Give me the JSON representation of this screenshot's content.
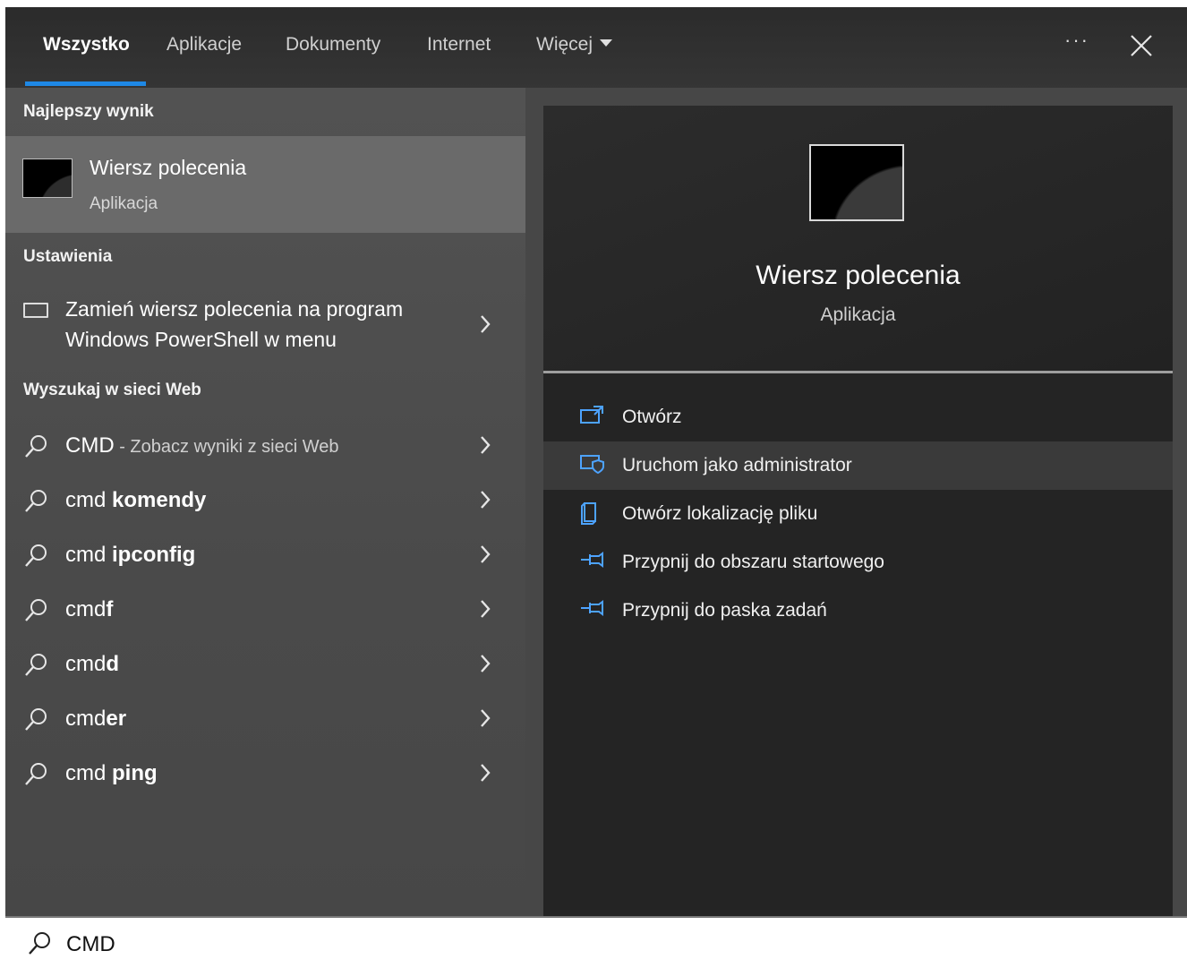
{
  "tabs": [
    {
      "label": "Wszystko",
      "active": true
    },
    {
      "label": "Aplikacje"
    },
    {
      "label": "Dokumenty"
    },
    {
      "label": "Internet"
    },
    {
      "label": "Więcej"
    }
  ],
  "top_actions": {
    "more": "···"
  },
  "best_match": {
    "heading": "Najlepszy wynik",
    "title": "Wiersz polecenia",
    "subtitle": "Aplikacja"
  },
  "settings": {
    "heading": "Ustawienia",
    "item_line1": "Zamień wiersz polecenia na program",
    "item_line2": "Windows PowerShell w menu"
  },
  "web": {
    "heading": "Wyszukaj w sieci Web",
    "items": [
      {
        "prefix": "CMD",
        "bold": "",
        "suffix": " - Zobacz wyniki z sieci Web"
      },
      {
        "prefix": "cmd ",
        "bold": "komendy",
        "suffix": ""
      },
      {
        "prefix": "cmd ",
        "bold": "ipconfig",
        "suffix": ""
      },
      {
        "prefix": "cmd",
        "bold": "f",
        "suffix": ""
      },
      {
        "prefix": "cmd",
        "bold": "d",
        "suffix": ""
      },
      {
        "prefix": "cmd",
        "bold": "er",
        "suffix": ""
      },
      {
        "prefix": "cmd ",
        "bold": "ping",
        "suffix": ""
      }
    ]
  },
  "preview": {
    "title": "Wiersz polecenia",
    "subtitle": "Aplikacja",
    "actions": [
      {
        "label": "Otwórz",
        "icon": "open-icon"
      },
      {
        "label": "Uruchom jako administrator",
        "icon": "admin-shield-icon",
        "highlighted": true
      },
      {
        "label": "Otwórz lokalizację pliku",
        "icon": "file-location-icon"
      },
      {
        "label": "Przypnij do obszaru startowego",
        "icon": "pin-icon"
      },
      {
        "label": "Przypnij do paska zadań",
        "icon": "pin-icon"
      }
    ]
  },
  "search": {
    "value": "CMD"
  },
  "colors": {
    "accent": "#1e88e5",
    "action_icon": "#4da3ff"
  }
}
